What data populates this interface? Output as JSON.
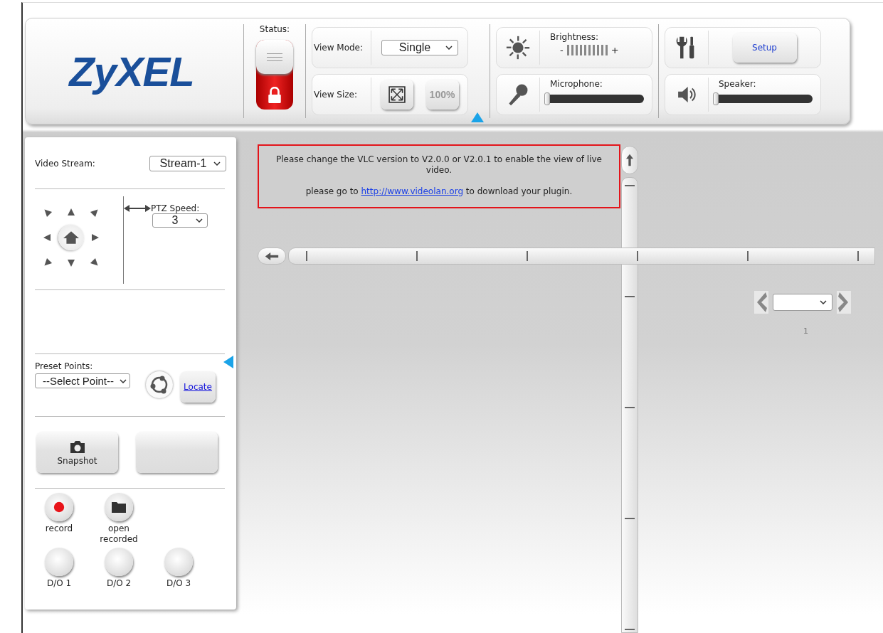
{
  "logo": "ZyXEL",
  "status": {
    "label": "Status:",
    "locked": true
  },
  "view_mode": {
    "label": "View Mode:",
    "value": "Single"
  },
  "view_size": {
    "label": "View Size:",
    "actual_size": "100%"
  },
  "brightness": {
    "label": "Brightness:",
    "minus": "-",
    "plus": "+"
  },
  "microphone": {
    "label": "Microphone:",
    "level": 0
  },
  "setup": {
    "label": "Setup"
  },
  "speaker": {
    "label": "Speaker:",
    "level": 0
  },
  "video_stream": {
    "label": "Video Stream:",
    "value": "Stream-1"
  },
  "ptz_speed": {
    "label": "PTZ Speed:",
    "value": "3"
  },
  "preset_points": {
    "label": "Preset Points:",
    "value": "--Select Point--",
    "locate": "Locate"
  },
  "snapshot": {
    "label": "Snapshot"
  },
  "actions": [
    {
      "kind": "record",
      "label": "record"
    },
    {
      "kind": "folder",
      "label": "open recorded"
    }
  ],
  "outputs": [
    "D/O 1",
    "D/O 2",
    "D/O 3"
  ],
  "message": {
    "text": "Please change the VLC version to V2.0.0 or V2.0.1 to enable the view of live video.",
    "before": "please go to",
    "link": "http://www.videolan.org",
    "after": "to download your plugin."
  },
  "pager": {
    "page": "1"
  }
}
